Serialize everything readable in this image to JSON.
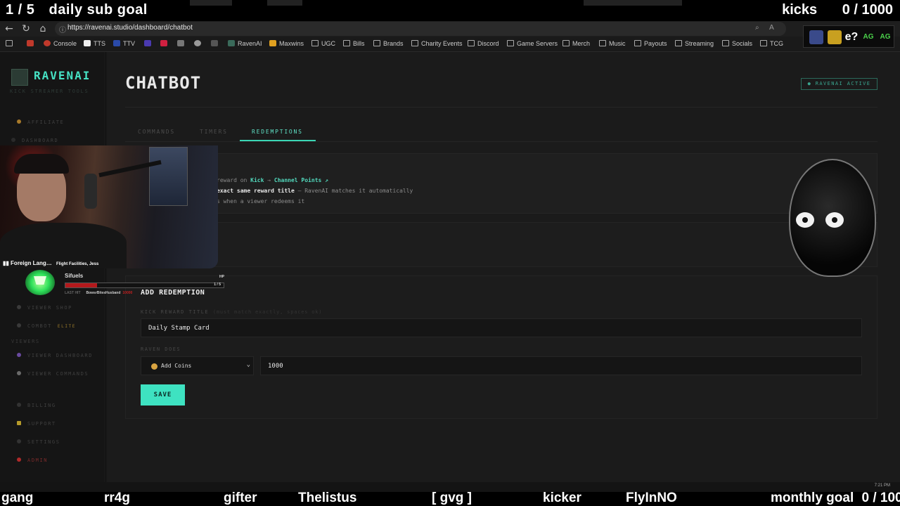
{
  "overlay": {
    "sub_goal_count": "1 / 5",
    "sub_goal_label": "daily sub goal",
    "kicks_label": "kicks",
    "kicks_count": "0 / 1000",
    "monthly_goal_label": "monthly goal",
    "monthly_goal_count": "0 / 100",
    "ticker": [
      "gang",
      "rr4g",
      "gifter",
      "Thelistus",
      "[ gvg ]",
      "kicker",
      "FlyInNO"
    ]
  },
  "browser": {
    "url": "https://ravenai.studio/dashboard/chatbot",
    "bookmarks": [
      "Console",
      "TTS",
      "TTV",
      "RavenAI",
      "Maxwins",
      "UGC",
      "Bills",
      "Brands",
      "Charity Events",
      "Discord",
      "Game Servers",
      "Merch",
      "Music",
      "Payouts",
      "Streaming",
      "Socials",
      "TCG"
    ],
    "extension_label": "e?",
    "extension_badge_1": "AG",
    "extension_badge_2": "AG"
  },
  "sidebar": {
    "logo_text": "RAVENAI",
    "logo_subtitle": "KICK STREAMER TOOLS",
    "items": [
      {
        "label": "AFFILIATE",
        "dot": "#a87a2a"
      },
      {
        "label": "DASHBOARD",
        "dot": "#3a3a3a"
      },
      {
        "label": "VIEWER SHOP",
        "dot": "#3a3a3a"
      },
      {
        "label": "COMBOT",
        "dot": "#3a3a3a",
        "tag": "ELITE"
      },
      {
        "label": "VIEWER DASHBOARD",
        "dot": "#6a4aa0"
      },
      {
        "label": "VIEWER COMMANDS",
        "dot": "#6a6a6a"
      },
      {
        "label": "BILLING",
        "dot": "#3a3a3a"
      },
      {
        "label": "SUPPORT",
        "dot": "#b59a2a"
      },
      {
        "label": "SETTINGS",
        "dot": "#3a3a3a"
      },
      {
        "label": "ADMIN",
        "dot": "#b02a2a"
      }
    ],
    "group_viewers": "VIEWERS"
  },
  "page": {
    "title": "CHATBOT",
    "status_badge": "● RAVENAI ACTIVE",
    "tabs": [
      "COMMANDS",
      "TIMERS",
      "REDEMPTIONS"
    ],
    "active_tab": "REDEMPTIONS"
  },
  "info": {
    "line1_pre": "reward on ",
    "line1_kick": "Kick",
    "line1_arrow": " → ",
    "line1_cp": "Channel Points ↗",
    "line2_bold": "exact same reward title",
    "line2_rest": " — RavenAI matches it automatically",
    "line3": "s when a viewer redeems it"
  },
  "form": {
    "title": "ADD REDEMPTION",
    "reward_label": "KICK REWARD TITLE",
    "reward_hint": "(must match exactly, spaces ok)",
    "reward_value": "Daily Stamp Card",
    "raven_label": "RAVEN DOES",
    "action_value": "Add Coins",
    "amount_value": "1000",
    "save_label": "SAVE"
  },
  "webcam": {
    "now_playing_song": "Foreign Lang…",
    "now_playing_artist": "Flight Facilities, Jess"
  },
  "pet": {
    "name": "Sifuels",
    "hp_label": "HP",
    "hp_value": "1 / 5",
    "hp_fraction": 0.2,
    "last_label": "LAST HIT",
    "last_user": "BowsrBitesHusband",
    "last_tag": "10000"
  },
  "taskbar": {
    "time": "7:21 PM"
  }
}
